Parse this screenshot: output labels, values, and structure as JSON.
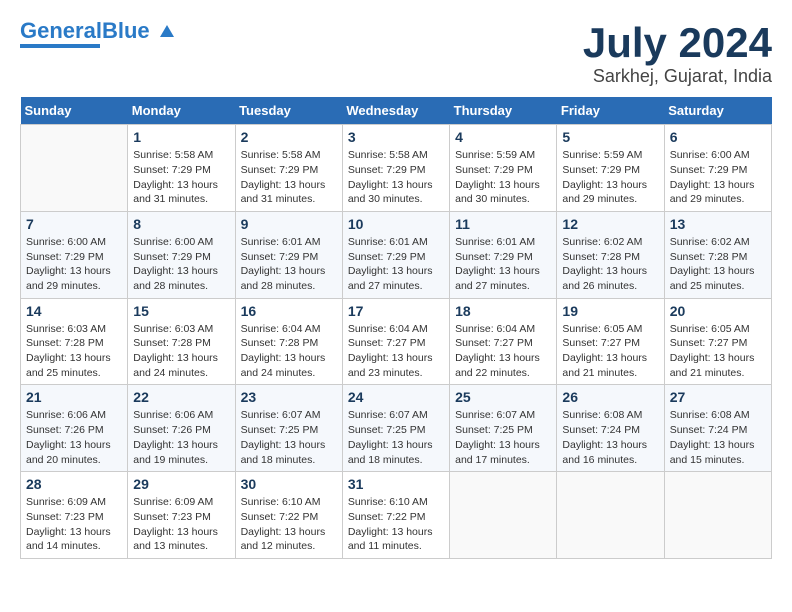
{
  "header": {
    "logo_line1": "General",
    "logo_line2": "Blue",
    "month_year": "July 2024",
    "location": "Sarkhej, Gujarat, India"
  },
  "weekdays": [
    "Sunday",
    "Monday",
    "Tuesday",
    "Wednesday",
    "Thursday",
    "Friday",
    "Saturday"
  ],
  "weeks": [
    [
      {
        "day": "",
        "info": ""
      },
      {
        "day": "1",
        "info": "Sunrise: 5:58 AM\nSunset: 7:29 PM\nDaylight: 13 hours\nand 31 minutes."
      },
      {
        "day": "2",
        "info": "Sunrise: 5:58 AM\nSunset: 7:29 PM\nDaylight: 13 hours\nand 31 minutes."
      },
      {
        "day": "3",
        "info": "Sunrise: 5:58 AM\nSunset: 7:29 PM\nDaylight: 13 hours\nand 30 minutes."
      },
      {
        "day": "4",
        "info": "Sunrise: 5:59 AM\nSunset: 7:29 PM\nDaylight: 13 hours\nand 30 minutes."
      },
      {
        "day": "5",
        "info": "Sunrise: 5:59 AM\nSunset: 7:29 PM\nDaylight: 13 hours\nand 29 minutes."
      },
      {
        "day": "6",
        "info": "Sunrise: 6:00 AM\nSunset: 7:29 PM\nDaylight: 13 hours\nand 29 minutes."
      }
    ],
    [
      {
        "day": "7",
        "info": "Sunrise: 6:00 AM\nSunset: 7:29 PM\nDaylight: 13 hours\nand 29 minutes."
      },
      {
        "day": "8",
        "info": "Sunrise: 6:00 AM\nSunset: 7:29 PM\nDaylight: 13 hours\nand 28 minutes."
      },
      {
        "day": "9",
        "info": "Sunrise: 6:01 AM\nSunset: 7:29 PM\nDaylight: 13 hours\nand 28 minutes."
      },
      {
        "day": "10",
        "info": "Sunrise: 6:01 AM\nSunset: 7:29 PM\nDaylight: 13 hours\nand 27 minutes."
      },
      {
        "day": "11",
        "info": "Sunrise: 6:01 AM\nSunset: 7:29 PM\nDaylight: 13 hours\nand 27 minutes."
      },
      {
        "day": "12",
        "info": "Sunrise: 6:02 AM\nSunset: 7:28 PM\nDaylight: 13 hours\nand 26 minutes."
      },
      {
        "day": "13",
        "info": "Sunrise: 6:02 AM\nSunset: 7:28 PM\nDaylight: 13 hours\nand 25 minutes."
      }
    ],
    [
      {
        "day": "14",
        "info": "Sunrise: 6:03 AM\nSunset: 7:28 PM\nDaylight: 13 hours\nand 25 minutes."
      },
      {
        "day": "15",
        "info": "Sunrise: 6:03 AM\nSunset: 7:28 PM\nDaylight: 13 hours\nand 24 minutes."
      },
      {
        "day": "16",
        "info": "Sunrise: 6:04 AM\nSunset: 7:28 PM\nDaylight: 13 hours\nand 24 minutes."
      },
      {
        "day": "17",
        "info": "Sunrise: 6:04 AM\nSunset: 7:27 PM\nDaylight: 13 hours\nand 23 minutes."
      },
      {
        "day": "18",
        "info": "Sunrise: 6:04 AM\nSunset: 7:27 PM\nDaylight: 13 hours\nand 22 minutes."
      },
      {
        "day": "19",
        "info": "Sunrise: 6:05 AM\nSunset: 7:27 PM\nDaylight: 13 hours\nand 21 minutes."
      },
      {
        "day": "20",
        "info": "Sunrise: 6:05 AM\nSunset: 7:27 PM\nDaylight: 13 hours\nand 21 minutes."
      }
    ],
    [
      {
        "day": "21",
        "info": "Sunrise: 6:06 AM\nSunset: 7:26 PM\nDaylight: 13 hours\nand 20 minutes."
      },
      {
        "day": "22",
        "info": "Sunrise: 6:06 AM\nSunset: 7:26 PM\nDaylight: 13 hours\nand 19 minutes."
      },
      {
        "day": "23",
        "info": "Sunrise: 6:07 AM\nSunset: 7:25 PM\nDaylight: 13 hours\nand 18 minutes."
      },
      {
        "day": "24",
        "info": "Sunrise: 6:07 AM\nSunset: 7:25 PM\nDaylight: 13 hours\nand 18 minutes."
      },
      {
        "day": "25",
        "info": "Sunrise: 6:07 AM\nSunset: 7:25 PM\nDaylight: 13 hours\nand 17 minutes."
      },
      {
        "day": "26",
        "info": "Sunrise: 6:08 AM\nSunset: 7:24 PM\nDaylight: 13 hours\nand 16 minutes."
      },
      {
        "day": "27",
        "info": "Sunrise: 6:08 AM\nSunset: 7:24 PM\nDaylight: 13 hours\nand 15 minutes."
      }
    ],
    [
      {
        "day": "28",
        "info": "Sunrise: 6:09 AM\nSunset: 7:23 PM\nDaylight: 13 hours\nand 14 minutes."
      },
      {
        "day": "29",
        "info": "Sunrise: 6:09 AM\nSunset: 7:23 PM\nDaylight: 13 hours\nand 13 minutes."
      },
      {
        "day": "30",
        "info": "Sunrise: 6:10 AM\nSunset: 7:22 PM\nDaylight: 13 hours\nand 12 minutes."
      },
      {
        "day": "31",
        "info": "Sunrise: 6:10 AM\nSunset: 7:22 PM\nDaylight: 13 hours\nand 11 minutes."
      },
      {
        "day": "",
        "info": ""
      },
      {
        "day": "",
        "info": ""
      },
      {
        "day": "",
        "info": ""
      }
    ]
  ]
}
